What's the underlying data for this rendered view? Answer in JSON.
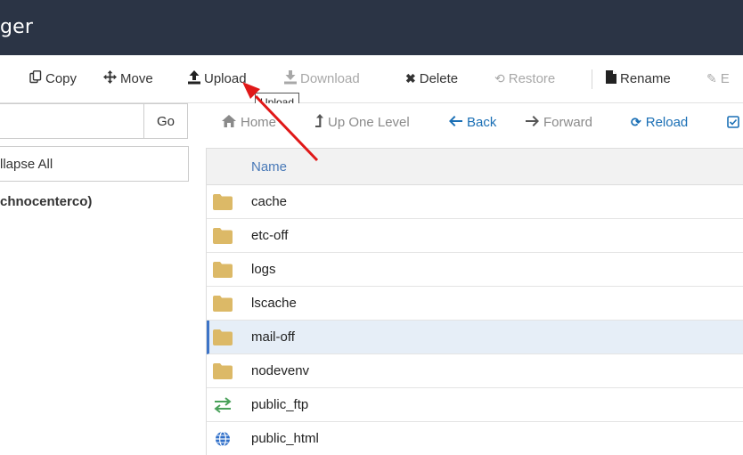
{
  "window": {
    "title": "ger"
  },
  "toolbar": {
    "copy": {
      "label": "Copy",
      "icon": "copy-icon"
    },
    "move": {
      "label": "Move",
      "icon": "move-icon"
    },
    "upload": {
      "label": "Upload",
      "icon": "upload-icon"
    },
    "download": {
      "label": "Download",
      "icon": "download-icon"
    },
    "delete": {
      "label": "Delete",
      "icon": "delete-icon"
    },
    "restore": {
      "label": "Restore",
      "icon": "restore-icon"
    },
    "rename": {
      "label": "Rename",
      "icon": "rename-icon"
    },
    "edit": {
      "label": "E",
      "icon": "edit-icon"
    }
  },
  "tooltip": {
    "text": "Upload"
  },
  "left_panel": {
    "go_label": "Go",
    "collapse_label": "llapse All",
    "tree_root": "chnocenterco)"
  },
  "navbar": {
    "home": "Home",
    "up_one_level": "Up One Level",
    "back": "Back",
    "forward": "Forward",
    "reload": "Reload"
  },
  "table": {
    "header_name": "Name",
    "rows": [
      {
        "name": "cache",
        "icon": "folder-icon"
      },
      {
        "name": "etc-off",
        "icon": "folder-icon"
      },
      {
        "name": "logs",
        "icon": "folder-icon"
      },
      {
        "name": "lscache",
        "icon": "folder-icon"
      },
      {
        "name": "mail-off",
        "icon": "folder-icon",
        "selected": true
      },
      {
        "name": "nodevenv",
        "icon": "folder-icon"
      },
      {
        "name": "public_ftp",
        "icon": "ftp-arrows-icon"
      },
      {
        "name": "public_html",
        "icon": "globe-icon"
      }
    ]
  },
  "colors": {
    "titlebar": "#2b3445",
    "folder": "#dcb967",
    "link_blue": "#1a6fb5",
    "selected_row": "#e6eef7",
    "annotation_arrow": "#e01818"
  }
}
